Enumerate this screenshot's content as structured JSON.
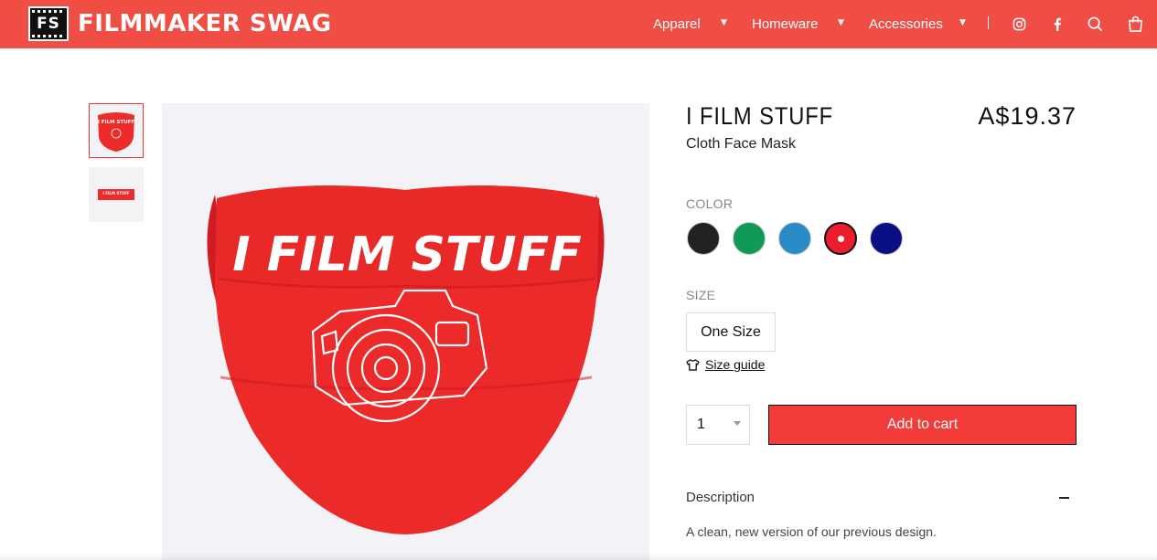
{
  "brand": {
    "logo_mark": "FS",
    "name": "FILMMAKER SWAG",
    "accent": "#f04e44",
    "button_color": "#f33b39"
  },
  "nav": {
    "items": [
      {
        "label": "Apparel"
      },
      {
        "label": "Homeware"
      },
      {
        "label": "Accessories"
      }
    ],
    "icons": [
      "instagram-icon",
      "facebook-icon",
      "search-icon",
      "cart-bag-icon"
    ]
  },
  "product": {
    "title": "I FILM STUFF",
    "price": "A$19.37",
    "subtitle": "Cloth Face Mask",
    "image_text": "I FILM STUFF",
    "thumb_text": "I FILM STUFF",
    "color_label": "COLOR",
    "colors": [
      {
        "name": "black",
        "hex": "#222222"
      },
      {
        "name": "green",
        "hex": "#119a55"
      },
      {
        "name": "blue",
        "hex": "#2b8bc7"
      },
      {
        "name": "red",
        "hex": "#ee1d2e",
        "selected": true
      },
      {
        "name": "navy",
        "hex": "#0b0f86"
      }
    ],
    "size_label": "SIZE",
    "size_value": "One Size",
    "size_guide": "Size guide",
    "quantity": "1",
    "add_to_cart": "Add to cart",
    "description_heading": "Description",
    "description": "A clean, new version of our previous design."
  }
}
